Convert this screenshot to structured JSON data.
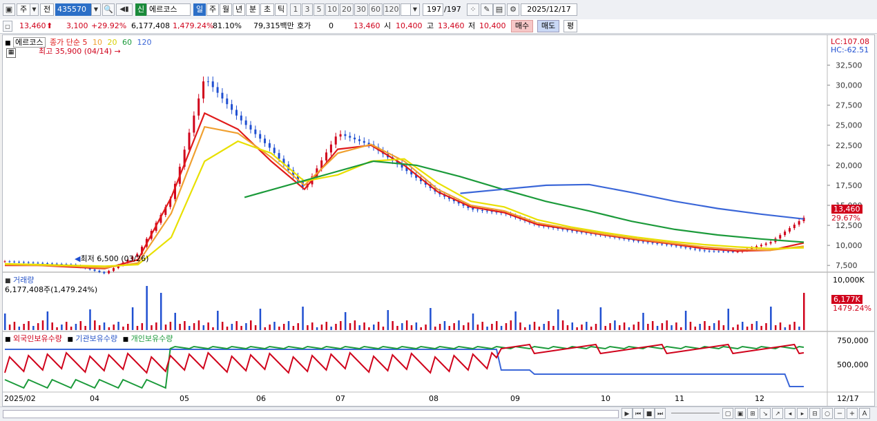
{
  "toolbar": {
    "main_btn": "주",
    "jeon_btn": "전",
    "stock_code": "435570",
    "sin_badge": "신",
    "stock_name": "에르코스",
    "periods": [
      "일",
      "주",
      "월",
      "년",
      "분",
      "초",
      "틱"
    ],
    "active_period": "일",
    "ticks": [
      "1",
      "3",
      "5",
      "10",
      "20",
      "30",
      "60",
      "120"
    ],
    "page_count": "197",
    "page_total": "/197",
    "date": "2025/12/17"
  },
  "info": {
    "price": "13,460",
    "change": "3,100",
    "change_pct": "+29.92%",
    "volume": "6,177,408",
    "vol_pct": "1,479.24%",
    "ratio": "81.10%",
    "amount": "79,315백만",
    "hoga_label": "호가",
    "hoga_val": "0",
    "hoga_price": "13,460",
    "open_label": "시",
    "open": "10,400",
    "high_label": "고",
    "high": "13,460",
    "low_label": "저",
    "low": "10,400",
    "buy": "매수",
    "sell": "매도",
    "avg": "평"
  },
  "legend": {
    "name": "에르코스",
    "close_label": "종가 단순",
    "ma": [
      {
        "label": "5",
        "color": "#e01b1b"
      },
      {
        "label": "10",
        "color": "#f0a030"
      },
      {
        "label": "20",
        "color": "#e8e000"
      },
      {
        "label": "60",
        "color": "#1b9a3a"
      },
      {
        "label": "120",
        "color": "#3a66d8"
      }
    ],
    "high_note": "최고 35,900 (04/14)",
    "low_note": "최저 6,500 (03/26)",
    "lc": "LC:107.08",
    "hc": "HC:-62.51",
    "price_tag": "13,460",
    "pct_tag": "29.67%"
  },
  "price_axis": [
    "32,500",
    "30,000",
    "27,500",
    "25,000",
    "22,500",
    "20,000",
    "17,500",
    "15,000",
    "12,500",
    "10,000",
    "7,500"
  ],
  "volume_panel": {
    "title": "거래량",
    "value": "6,177,408주(1,479.24%)",
    "axis_top": "10,000K",
    "tag": "6,177K",
    "tag_pct": "1479.24%"
  },
  "holding_panel": {
    "labels": [
      "외국인보유수량",
      "기관보유수량",
      "개인보유수량"
    ],
    "axis": [
      "750,000",
      "500,000"
    ]
  },
  "x_axis": [
    "2025/02",
    "04",
    "05",
    "06",
    "07",
    "08",
    "09",
    "10",
    "11",
    "12",
    "12/17"
  ],
  "colors": {
    "up": "#d0021b",
    "down": "#1f4fd1",
    "ma5": "#e01b1b",
    "ma10": "#f0a030",
    "ma20": "#e8e000",
    "ma60": "#1b9a3a",
    "ma120": "#3a66d8"
  },
  "chart_data": [
    {
      "type": "candlestick",
      "title": "에르코스",
      "ylim": [
        7000,
        35900
      ],
      "x": [
        "2025/02",
        "04",
        "05",
        "06",
        "07",
        "08",
        "09",
        "10",
        "11",
        "12",
        "12/17"
      ],
      "series": [
        {
          "name": "종가",
          "values": [
            8000,
            7800,
            7600,
            6500,
            9000,
            16000,
            31000,
            26000,
            22000,
            17000,
            24000,
            22500,
            19500,
            16500,
            14500,
            14000,
            12500,
            11800,
            11200,
            10500,
            10000,
            9300,
            9200,
            10400,
            13460
          ]
        },
        {
          "name": "5",
          "values": [
            7500,
            7500,
            7300,
            7100,
            8200,
            16000,
            26500,
            24500,
            20500,
            17000,
            22000,
            22500,
            20000,
            16700,
            14800,
            14100,
            12600,
            12000,
            11300,
            10700,
            10200,
            9600,
            9300,
            9400,
            10300
          ]
        },
        {
          "name": "10",
          "values": [
            7600,
            7500,
            7400,
            7200,
            7800,
            14000,
            24800,
            24000,
            21000,
            17500,
            21500,
            22600,
            20500,
            17000,
            15000,
            14300,
            12800,
            12100,
            11400,
            10800,
            10300,
            9800,
            9500,
            9400,
            9900
          ]
        },
        {
          "name": "20",
          "values": [
            7700,
            7600,
            7500,
            7400,
            7600,
            11000,
            20500,
            23000,
            21500,
            18000,
            18800,
            20500,
            20800,
            17800,
            15500,
            14800,
            13200,
            12300,
            11600,
            11000,
            10500,
            10100,
            9800,
            9600,
            9700
          ]
        },
        {
          "name": "60",
          "values": [
            16000,
            17500,
            19000,
            20500,
            20000,
            18600,
            17000,
            15500,
            14300,
            13000,
            12000,
            11300,
            10800,
            10400
          ]
        },
        {
          "name": "120",
          "values": [
            16500,
            17000,
            17500,
            17600,
            16600,
            15500,
            14600,
            13900,
            13300
          ]
        }
      ]
    }
  ]
}
